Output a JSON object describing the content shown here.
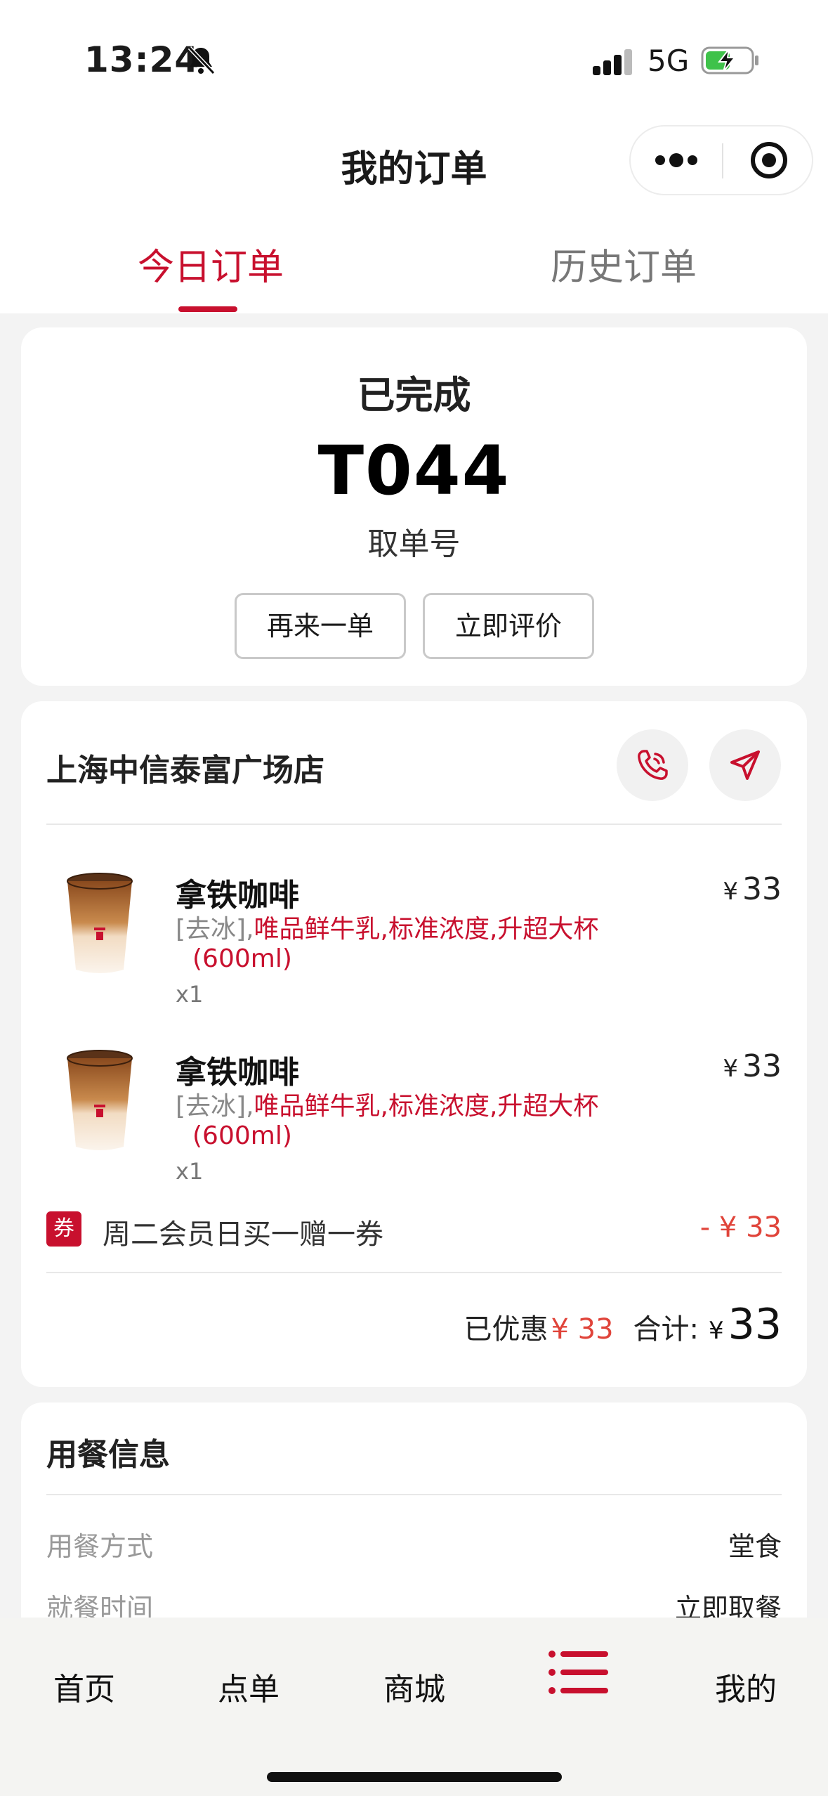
{
  "status_bar": {
    "time": "13:24",
    "network": "5G",
    "icons": [
      "bell-slash-icon",
      "cellular-signal-icon",
      "battery-charging-icon"
    ]
  },
  "nav": {
    "title": "我的订单",
    "icons": [
      "more-dots-icon",
      "close-target-icon"
    ]
  },
  "tabs": [
    {
      "label": "今日订单",
      "active": true
    },
    {
      "label": "历史订单",
      "active": false
    }
  ],
  "order_status": {
    "status": "已完成",
    "pickup_number": "T044",
    "pickup_label": "取单号",
    "reorder_label": "再来一单",
    "review_label": "立即评价"
  },
  "store": {
    "name": "上海中信泰富广场店",
    "icons": [
      "phone-icon",
      "navigation-arrow-icon"
    ]
  },
  "items": [
    {
      "name": "拿铁咖啡",
      "price": "33",
      "currency": "¥",
      "spec_muted": "[去冰],",
      "spec_highlight": "唯品鲜牛乳,标准浓度,升超大杯",
      "spec_size": "(600ml)",
      "quantity": "x1"
    },
    {
      "name": "拿铁咖啡",
      "price": "33",
      "currency": "¥",
      "spec_muted": "[去冰],",
      "spec_highlight": "唯品鲜牛乳,标准浓度,升超大杯",
      "spec_size": "(600ml)",
      "quantity": "x1"
    }
  ],
  "coupon": {
    "badge": "券",
    "name": "周二会员日买一赠一券",
    "value": "- ¥ 33"
  },
  "summary": {
    "saved_label": "已优惠",
    "saved_amount": "¥ 33",
    "total_label": "合计:",
    "total_currency": "¥",
    "total_amount": "33"
  },
  "dining": {
    "title": "用餐信息",
    "rows": [
      {
        "label": "用餐方式",
        "value": "堂食"
      },
      {
        "label": "就餐时间",
        "value": "立即取餐"
      }
    ]
  },
  "bottom_nav": {
    "items": [
      "首页",
      "点单",
      "商城",
      "我的"
    ],
    "active_icon": "order-list-icon"
  },
  "colors": {
    "accent": "#c8102e",
    "discount": "#e0443a",
    "background": "#f3f3f3"
  }
}
